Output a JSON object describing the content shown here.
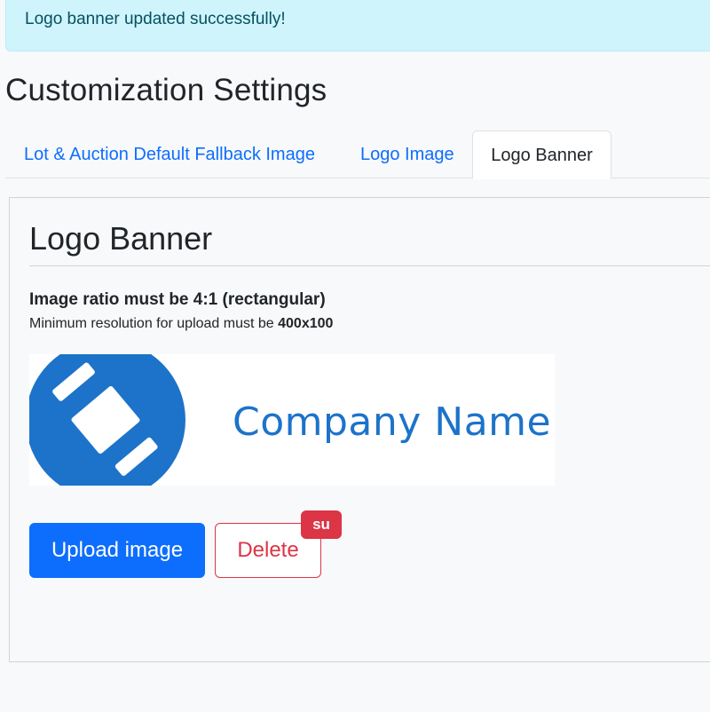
{
  "alert": {
    "message": "Logo banner updated successfully!"
  },
  "page": {
    "title": "Customization Settings"
  },
  "tabs": [
    {
      "label": "Lot & Auction Default Fallback Image",
      "active": false
    },
    {
      "label": "Logo Image",
      "active": false
    },
    {
      "label": "Logo Banner",
      "active": true
    }
  ],
  "panel": {
    "title": "Logo Banner",
    "ratio_text": "Image ratio must be 4:1 (rectangular)",
    "resolution_prefix": "Minimum resolution for upload must be ",
    "resolution_value": "400x100",
    "banner": {
      "company_name": "Company Name",
      "brand_color": "#1d73c9"
    }
  },
  "actions": {
    "upload_label": "Upload image",
    "delete_label": "Delete",
    "badge_label": "su"
  },
  "colors": {
    "primary": "#0d6efd",
    "danger": "#dc3545",
    "info_bg": "#cff4fc",
    "info_text": "#055160"
  }
}
